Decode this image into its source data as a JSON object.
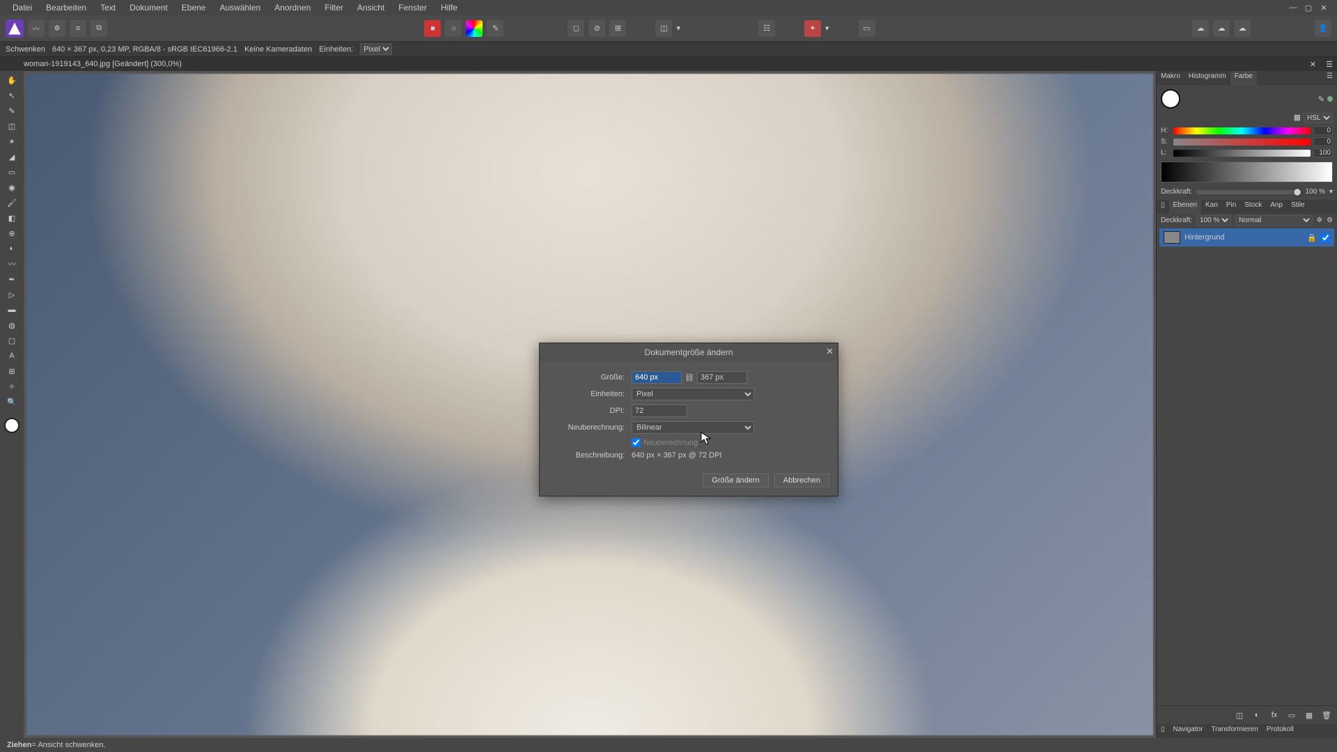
{
  "menu": [
    "Datei",
    "Bearbeiten",
    "Text",
    "Dokument",
    "Ebene",
    "Auswählen",
    "Anordnen",
    "Filter",
    "Ansicht",
    "Fenster",
    "Hilfe"
  ],
  "contextbar": {
    "tool": "Schwenken",
    "imginfo": "640 × 367 px, 0,23 MP, RGBA/8 - sRGB IEC61966-2.1",
    "camera": "Keine Kameradaten",
    "units_label": "Einheiten:",
    "units_value": "Pixel"
  },
  "doctab": "woman-1919143_640.jpg [Geändert] (300,0%)",
  "dialog": {
    "title": "Dokumentgröße ändern",
    "size_label": "Größe:",
    "width": "640 px",
    "height": "367 px",
    "units_label": "Einheiten:",
    "units": "Pixel",
    "dpi_label": "DPI:",
    "dpi": "72",
    "resample_label": "Neuberechnung:",
    "resample": "Bilinear",
    "resample_check": "Neuberechnung",
    "desc_label": "Beschreibung:",
    "desc": "640 px × 367 px @ 72 DPI",
    "ok": "Größe ändern",
    "cancel": "Abbrechen"
  },
  "rightpanel": {
    "tabs_top": [
      "Makro",
      "Histogramm",
      "Farbe"
    ],
    "hsl_mode": "HSL",
    "h": "0",
    "s": "0",
    "l": "100",
    "opacity_label": "Deckkraft:",
    "opacity_value": "100 %",
    "layer_tabs": [
      "Ebenen",
      "Kan",
      "Pin",
      "Stock",
      "Anp",
      "Stile"
    ],
    "layer_opacity_label": "Deckkraft:",
    "layer_opacity": "100 %",
    "blend": "Normal",
    "layer_name": "Hintergrund",
    "bottom_tabs": [
      "Navigator",
      "Transformieren",
      "Protokoll"
    ]
  },
  "status": {
    "bold": "Ziehen",
    "rest": " = Ansicht schwenken."
  }
}
